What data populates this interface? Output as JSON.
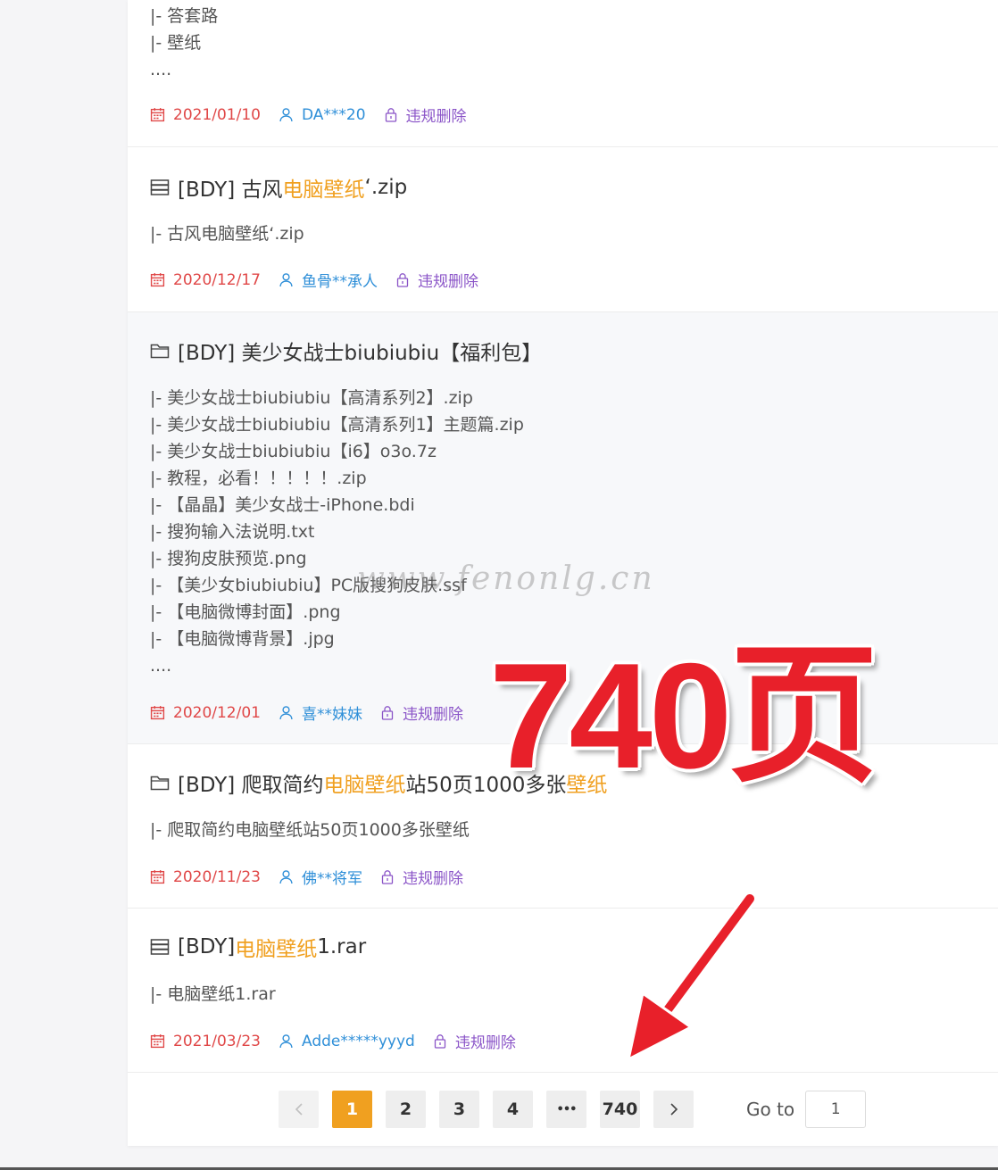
{
  "items": [
    {
      "kind": "folder",
      "title_parts": [],
      "files": [
        "|- 答套路",
        "|- 壁纸",
        "...."
      ],
      "date": "2021/01/10",
      "user": "DA***20",
      "report": "违规删除"
    },
    {
      "kind": "file",
      "title_parts": [
        "[BDY] 古风",
        "电脑壁纸",
        "‘.zip"
      ],
      "files": [
        "|- 古风电脑壁纸‘.zip"
      ],
      "date": "2020/12/17",
      "user": "鱼骨**承人",
      "report": "违规删除"
    },
    {
      "kind": "folder",
      "title_parts": [
        "[BDY] 美少女战士biubiubiu【福利包】",
        "",
        ""
      ],
      "files": [
        "|- 美少女战士biubiubiu【高清系列2】.zip",
        "|- 美少女战士biubiubiu【高清系列1】主题篇.zip",
        "|- 美少女战士biubiubiu【i6】o3o.7z",
        "|- 教程，必看！！！！！.zip",
        "|- 【晶晶】美少女战士-iPhone.bdi",
        "|- 搜狗输入法说明.txt",
        "|- 搜狗皮肤预览.png",
        "|- 【美少女biubiubiu】PC版搜狗皮肤.ssf",
        "|- 【电脑微博封面】.png",
        "|- 【电脑微博背景】.jpg",
        "...."
      ],
      "date": "2020/12/01",
      "user": "喜**妹妹",
      "report": "违规删除"
    },
    {
      "kind": "folder",
      "title_parts": [
        "[BDY] 爬取简约",
        "电脑壁纸",
        "站50页1000多张",
        "壁纸"
      ],
      "files": [
        "|- 爬取简约电脑壁纸站50页1000多张壁纸"
      ],
      "date": "2020/11/23",
      "user": "佛**将军",
      "report": "违规删除"
    },
    {
      "kind": "file",
      "title_parts": [
        "[BDY] ",
        "电脑壁纸",
        "1.rar"
      ],
      "files": [
        "|- 电脑壁纸1.rar"
      ],
      "date": "2021/03/23",
      "user": "Adde*****yyyd",
      "report": "违规删除"
    }
  ],
  "pagination": {
    "prev": "‹",
    "pages": [
      "1",
      "2",
      "3",
      "4",
      "•••",
      "740"
    ],
    "next": "›",
    "goto_label": "Go to",
    "goto_value": "1"
  },
  "overlay": {
    "watermark": "www.fenonlg.cn",
    "big_count": "740页"
  },
  "colors": {
    "highlight": "#f0a020",
    "date": "#e04848",
    "user": "#2f8fd8",
    "report": "#8b55c8",
    "active_page": "#f0a020",
    "annotation": "#e8202a"
  }
}
